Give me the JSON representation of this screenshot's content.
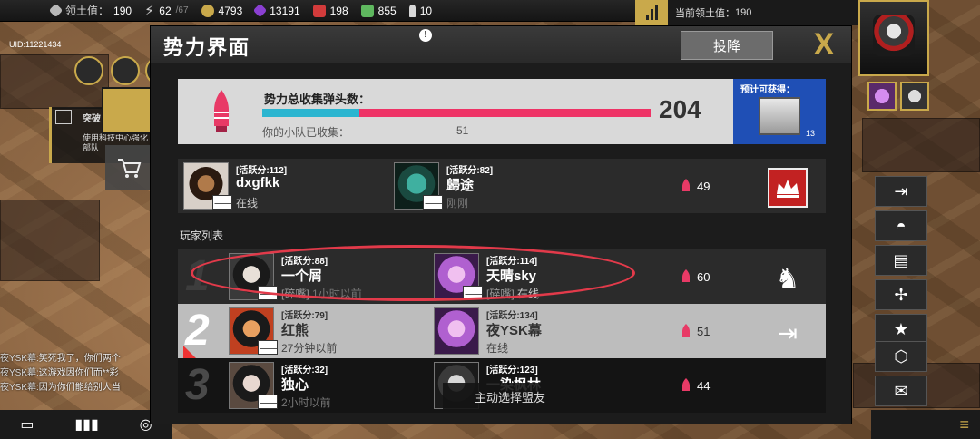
{
  "topbar": {
    "resources": [
      {
        "label": "领土值：",
        "value": "190",
        "icon": "territory-icon",
        "color": "#b8b8b8"
      },
      {
        "label": "",
        "value": "62",
        "extra": "/67",
        "icon": "energy-icon",
        "color": "#cfcfcf"
      },
      {
        "label": "",
        "value": "4793",
        "icon": "coin-icon",
        "color": "#c9a94b"
      },
      {
        "label": "",
        "value": "13191",
        "icon": "crystal-icon",
        "color": "#8a3fd1"
      },
      {
        "label": "",
        "value": "198",
        "icon": "ticket-icon",
        "color": "#d23b3b"
      },
      {
        "label": "",
        "value": "855",
        "icon": "chip-icon",
        "color": "#5fb85f"
      },
      {
        "label": "",
        "value": "10",
        "icon": "warhead-icon",
        "color": "#d8d8d8"
      }
    ],
    "territory_text": "当前领土值：",
    "territory_value": "190"
  },
  "uid": "UID:11221434",
  "left": {
    "panel_title": "突破",
    "panel_text": "使用科技中心强化部队"
  },
  "chat": [
    {
      "name": "夜YSK幕:",
      "text": "笑死我了，你们两个"
    },
    {
      "name": "夜YSK幕:",
      "text": "这游戏因你们而**彩"
    },
    {
      "name": "夜YSK幕:",
      "text": "因为你们能给别人当"
    }
  ],
  "dialog": {
    "title": "势力界面",
    "surrender_label": "投降",
    "close_label": "X",
    "warhead": {
      "label": "势力总收集弹头数：",
      "total": "204",
      "squad_label": "你的小队已收集：",
      "squad_value": "51",
      "progress": 0.25
    },
    "reward": {
      "label": "预计可获得：",
      "count": "13"
    },
    "leader_row": {
      "members": [
        {
          "activity": "[活跃分:112]",
          "name": "dxgfkk",
          "status": "在线",
          "online": true
        },
        {
          "activity": "[活跃分:82]",
          "name": "歸途",
          "status": "刚刚",
          "online": false
        }
      ],
      "count": "49"
    },
    "section_label": "玩家列表",
    "rows": [
      {
        "rank": "1",
        "members": [
          {
            "activity": "[活跃分:88]",
            "name": "一个屑",
            "tag": "[碎嘴]",
            "status": "1小时以前",
            "online": false
          },
          {
            "activity": "[活跃分:114]",
            "name": "天晴sky",
            "tag": "[碎嘴]",
            "status": "在线",
            "online": true
          }
        ],
        "count": "60"
      },
      {
        "rank": "2",
        "members": [
          {
            "activity": "[活跃分:79]",
            "name": "红熊",
            "tag": "",
            "status": "27分钟以前",
            "online": false
          },
          {
            "activity": "[活跃分:134]",
            "name": "夜YSK幕",
            "tag": "",
            "status": "在线",
            "online": true
          }
        ],
        "count": "51"
      },
      {
        "rank": "3",
        "members": [
          {
            "activity": "[活跃分:32]",
            "name": "独心",
            "tag": "",
            "status": "2小时以前",
            "online": false
          },
          {
            "activity": "[活跃分:123]",
            "name": "一染枫林",
            "tag": "",
            "status": "",
            "online": false
          }
        ],
        "count": "44"
      }
    ],
    "auto_select_label": "主动选择盟友"
  }
}
